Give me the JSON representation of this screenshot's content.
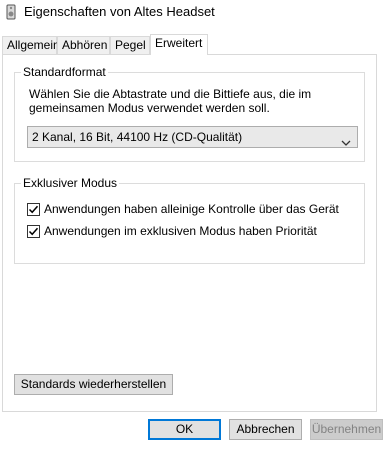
{
  "window": {
    "title": "Eigenschaften von Altes Headset",
    "icon": "speaker-icon"
  },
  "tabs": [
    {
      "label": "Allgemein"
    },
    {
      "label": "Abhören"
    },
    {
      "label": "Pegel"
    },
    {
      "label": "Erweitert"
    }
  ],
  "standardformat": {
    "title": "Standardformat",
    "description_line1": "Wählen Sie die Abtastrate und die Bittiefe aus, die im",
    "description_line2": "gemeinsamen Modus verwendet werden soll.",
    "selected_format": "2 Kanal, 16 Bit, 44100 Hz (CD-Qualität)"
  },
  "exclusive": {
    "title": "Exklusiver Modus",
    "option1": {
      "label": "Anwendungen haben alleinige Kontrolle über das Gerät",
      "checked": true
    },
    "option2": {
      "label": "Anwendungen im exklusiven Modus haben Priorität",
      "checked": true
    }
  },
  "buttons": {
    "restore": "Standards wiederherstellen",
    "ok": "OK",
    "cancel": "Abbrechen",
    "apply": "Übernehmen"
  }
}
